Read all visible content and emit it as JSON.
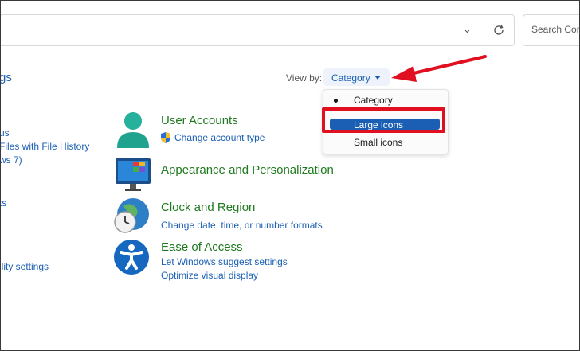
{
  "address_bar": {
    "search_placeholder": "Search Cont"
  },
  "left_nav": {
    "item_gs": "gs",
    "item_us": "us",
    "item_files": "Files with File History",
    "item_ws7": "ws 7)",
    "item_ts": "ts",
    "item_ility": "ility settings"
  },
  "view_by": {
    "label": "View by:",
    "value": "Category",
    "options": [
      {
        "label": "Category",
        "selected": true
      },
      {
        "label": "Large icons",
        "highlighted": true
      },
      {
        "label": "Small icons",
        "selected": false
      }
    ]
  },
  "categories": [
    {
      "title": "User Accounts",
      "links": [
        "Change account type"
      ]
    },
    {
      "title": "Appearance and Personalization",
      "links": []
    },
    {
      "title": "Clock and Region",
      "links": [
        "Change date, time, or number formats"
      ]
    },
    {
      "title": "Ease of Access",
      "links": [
        "Let Windows suggest settings",
        "Optimize visual display"
      ]
    }
  ],
  "colors": {
    "link": "#1a5fb4",
    "category_title": "#1f7a1f",
    "annotation_red": "#e01020",
    "menu_highlight": "#1a5fb4"
  }
}
